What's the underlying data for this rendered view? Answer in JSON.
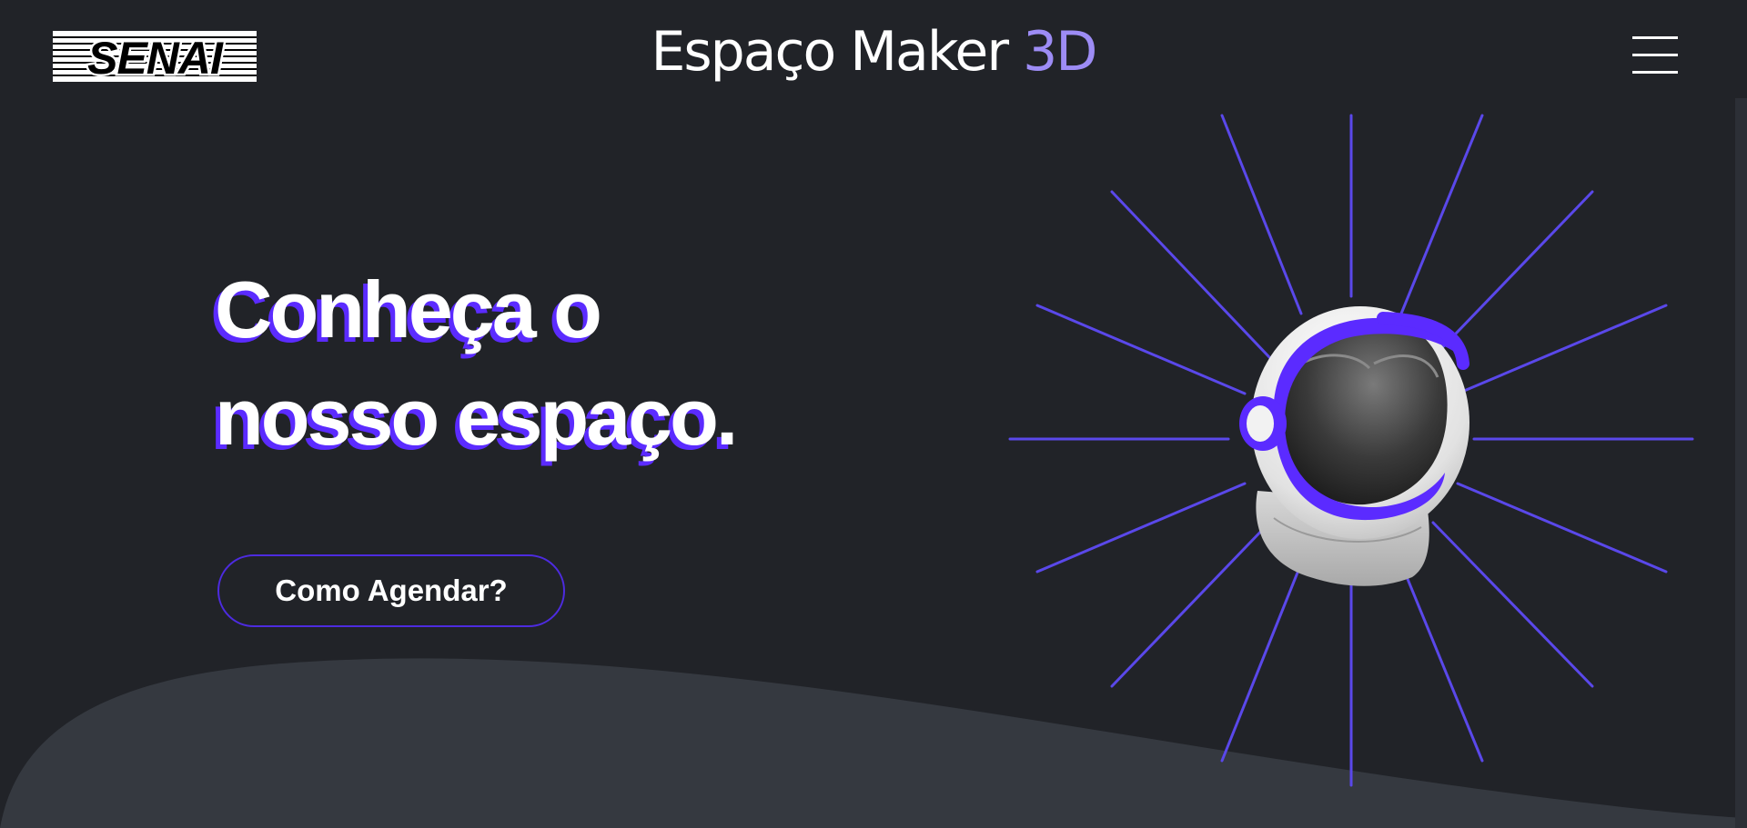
{
  "header": {
    "logo_text": "SENAI",
    "brand_main": "Espaço Maker",
    "brand_accent": "3D",
    "menu_icon": "hamburger-menu-icon"
  },
  "hero": {
    "title_line1": "Conheça o",
    "title_line2": "nosso espaço.",
    "cta_label": "Como Agendar?",
    "illustration": "astronaut-helmet"
  },
  "colors": {
    "background": "#212328",
    "wave": "#353940",
    "accent_purple": "#5b2bff",
    "rays": "#5a48ea",
    "brand_accent": "#9d8cf5",
    "text": "#ffffff"
  }
}
